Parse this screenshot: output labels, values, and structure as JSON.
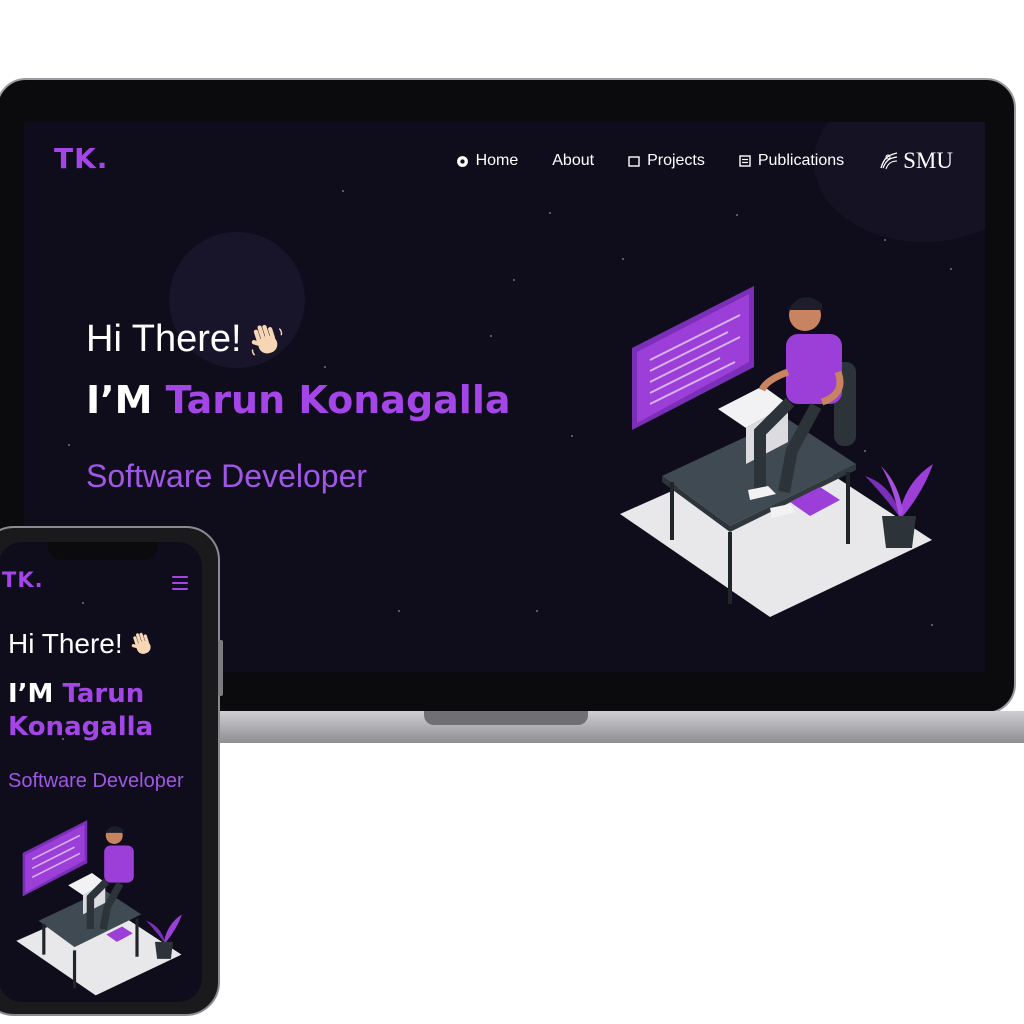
{
  "desktop": {
    "logo": "TK.",
    "nav": [
      {
        "label": "Home",
        "icon": "home-icon"
      },
      {
        "label": "About",
        "icon": "none"
      },
      {
        "label": "Projects",
        "icon": "projects-icon"
      },
      {
        "label": "Publications",
        "icon": "publications-icon"
      }
    ],
    "university_logo": "SMU",
    "greeting": "Hi There!",
    "greeting_emoji": "waving-hand-icon",
    "name_prefix": "I’M",
    "name": "Tarun Konagalla",
    "role": "Software Developer"
  },
  "mobile": {
    "logo": "TK.",
    "menu_icon": "hamburger-menu-icon",
    "greeting": "Hi There!",
    "name_prefix": "I’M",
    "name_first": "Tarun",
    "name_last": "Konagalla",
    "role": "Software Developer"
  },
  "colors": {
    "background": "#0f0d1b",
    "accent": "#a445e8",
    "text": "#ffffff"
  }
}
